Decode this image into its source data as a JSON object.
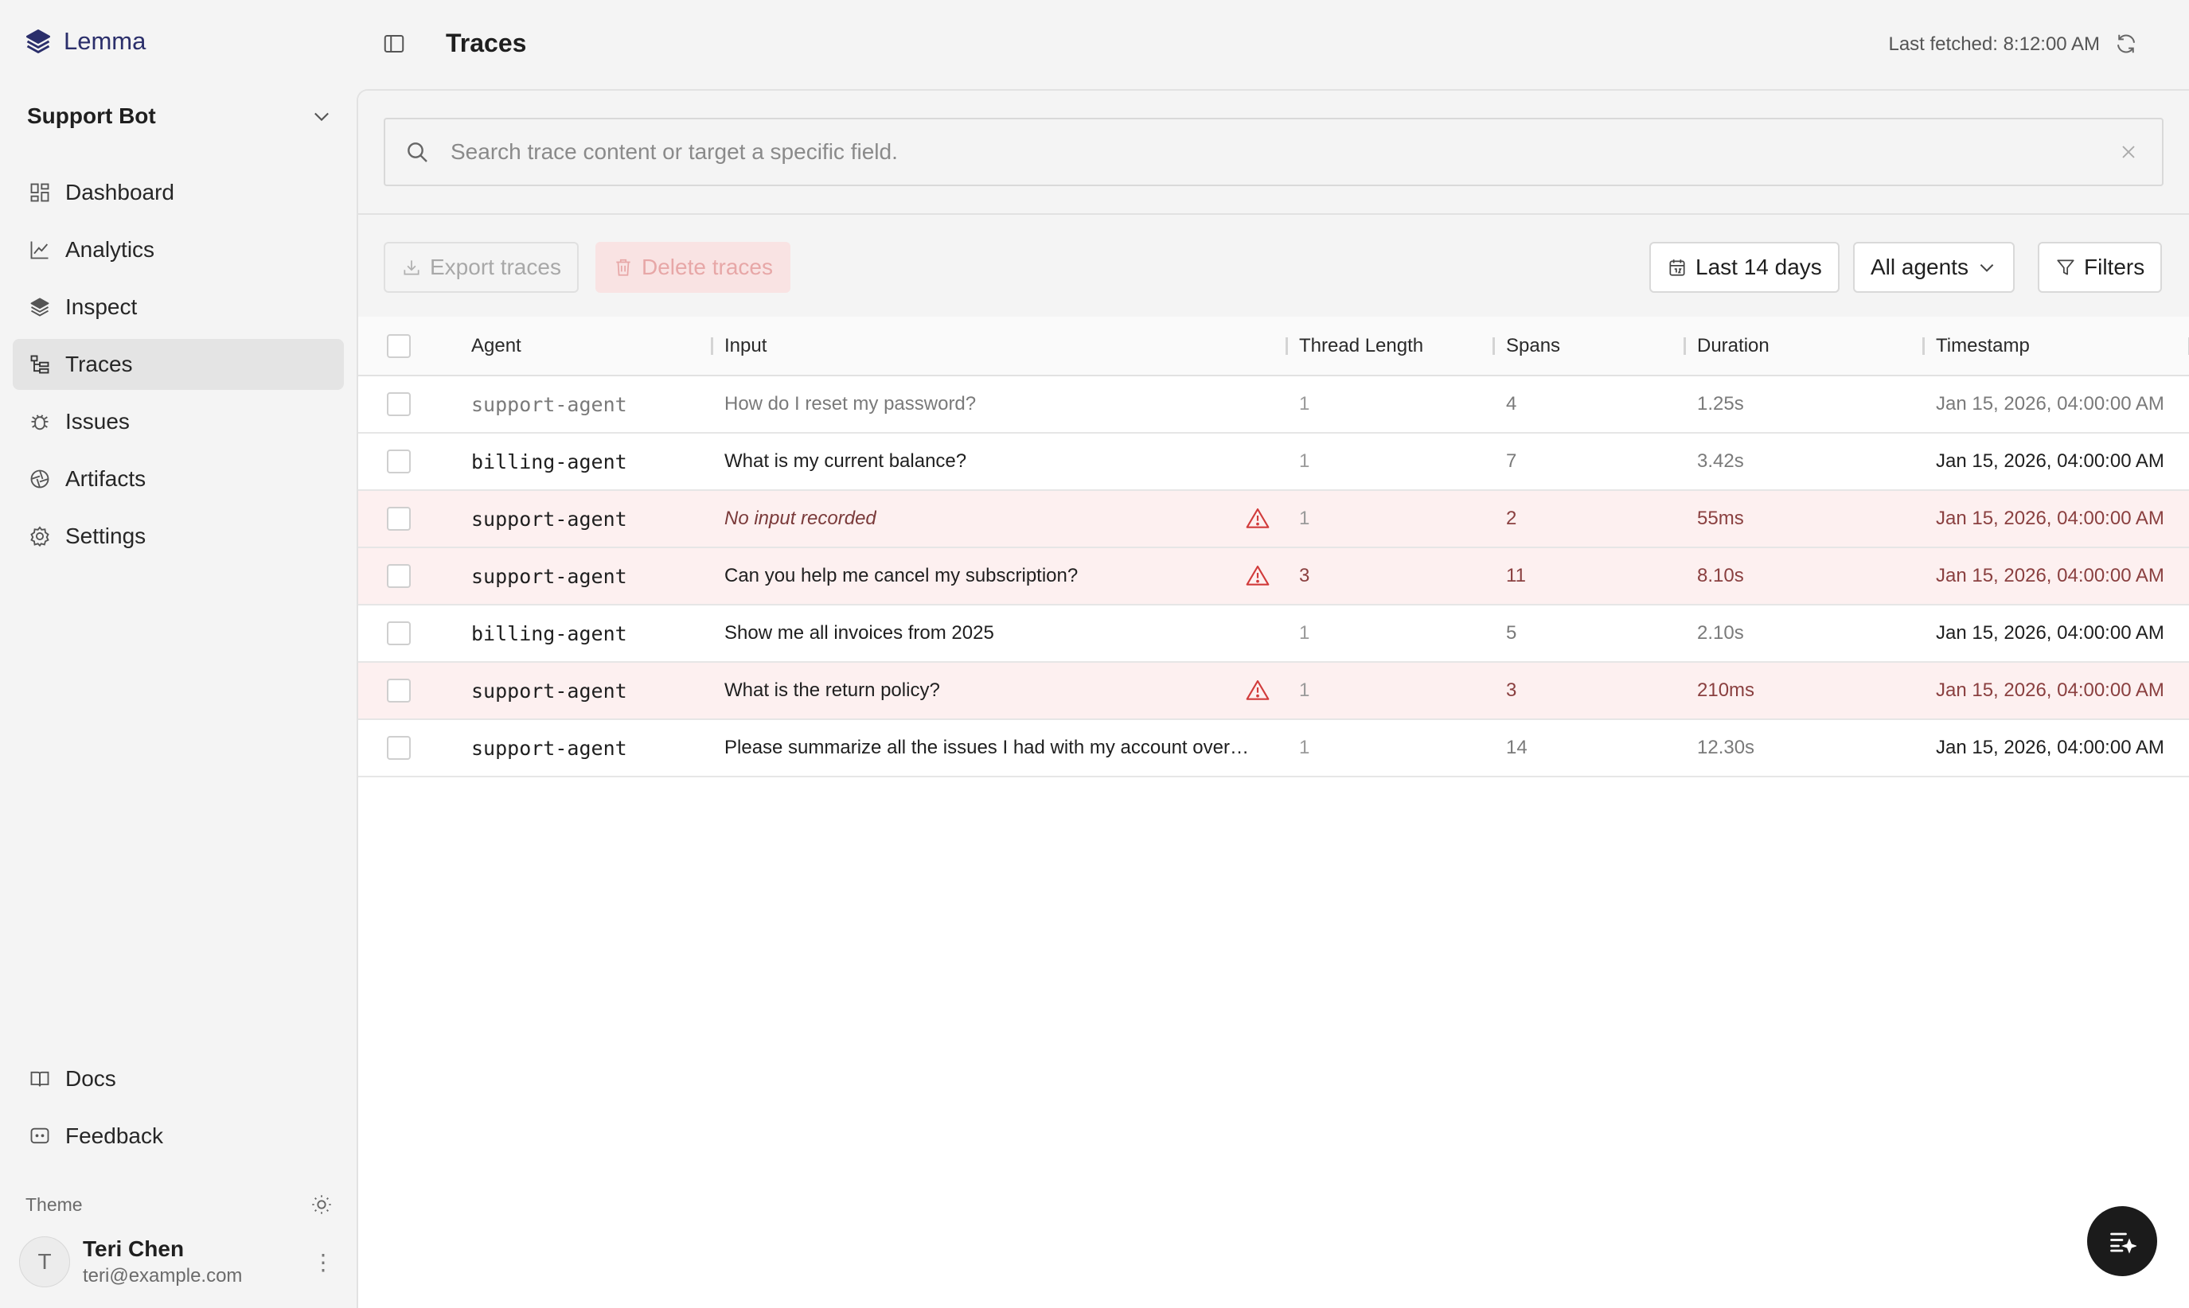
{
  "brand": {
    "name": "Lemma"
  },
  "project": {
    "name": "Support Bot"
  },
  "nav": {
    "dashboard": "Dashboard",
    "analytics": "Analytics",
    "inspect": "Inspect",
    "traces": "Traces",
    "issues": "Issues",
    "artifacts": "Artifacts",
    "settings": "Settings"
  },
  "nav_bottom": {
    "docs": "Docs",
    "feedback": "Feedback"
  },
  "theme": {
    "label": "Theme"
  },
  "user": {
    "initial": "T",
    "name": "Teri Chen",
    "email": "teri@example.com",
    "menu": "⋮"
  },
  "header": {
    "title": "Traces",
    "last_fetched": "Last fetched: 8:12:00 AM"
  },
  "search": {
    "placeholder": "Search trace content or target a specific field."
  },
  "toolbar": {
    "export_label": "Export traces",
    "delete_label": "Delete traces",
    "date_range": "Last 14 days",
    "agents": "All agents",
    "filters": "Filters"
  },
  "table": {
    "columns": {
      "agent": "Agent",
      "input": "Input",
      "thread_length": "Thread Length",
      "spans": "Spans",
      "duration": "Duration",
      "timestamp": "Timestamp"
    },
    "rows": [
      {
        "agent": "support-agent",
        "input": "How do I reset my password?",
        "thread_length": "1",
        "spans": "4",
        "duration": "1.25s",
        "timestamp": "Jan 15, 2026, 04:00:00 AM",
        "error": false
      },
      {
        "agent": "billing-agent",
        "input": "What is my current balance?",
        "thread_length": "1",
        "spans": "7",
        "duration": "3.42s",
        "timestamp": "Jan 15, 2026, 04:00:00 AM",
        "error": false
      },
      {
        "agent": "support-agent",
        "input": "No input recorded",
        "thread_length": "1",
        "spans": "2",
        "duration": "55ms",
        "timestamp": "Jan 15, 2026, 04:00:00 AM",
        "error": true
      },
      {
        "agent": "support-agent",
        "input": "Can you help me cancel my subscription?",
        "thread_length": "3",
        "spans": "11",
        "duration": "8.10s",
        "timestamp": "Jan 15, 2026, 04:00:00 AM",
        "error": true
      },
      {
        "agent": "billing-agent",
        "input": "Show me all invoices from 2025",
        "thread_length": "1",
        "spans": "5",
        "duration": "2.10s",
        "timestamp": "Jan 15, 2026, 04:00:00 AM",
        "error": false
      },
      {
        "agent": "support-agent",
        "input": "What is the return policy?",
        "thread_length": "1",
        "spans": "3",
        "duration": "210ms",
        "timestamp": "Jan 15, 2026, 04:00:00 AM",
        "error": true
      },
      {
        "agent": "support-agent",
        "input": "Please summarize all the issues I had with my account over…",
        "thread_length": "1",
        "spans": "14",
        "duration": "12.30s",
        "timestamp": "Jan 15, 2026, 04:00:00 AM",
        "error": false
      }
    ]
  },
  "icons": {
    "brand": "layers-logo-icon",
    "project_toggle": "chevron-down-icon",
    "panel_toggle": "sidebar-panel-icon",
    "refresh": "refresh-icon",
    "search": "search-icon",
    "clear": "close-icon",
    "warning": "warning-triangle-icon",
    "fab": "ai-chat-icon"
  },
  "colors": {
    "brand": "#2b2f6b",
    "error_row": "#fdf0f0",
    "warning": "#d13b3b",
    "delete_button": "#f9e3e3"
  }
}
